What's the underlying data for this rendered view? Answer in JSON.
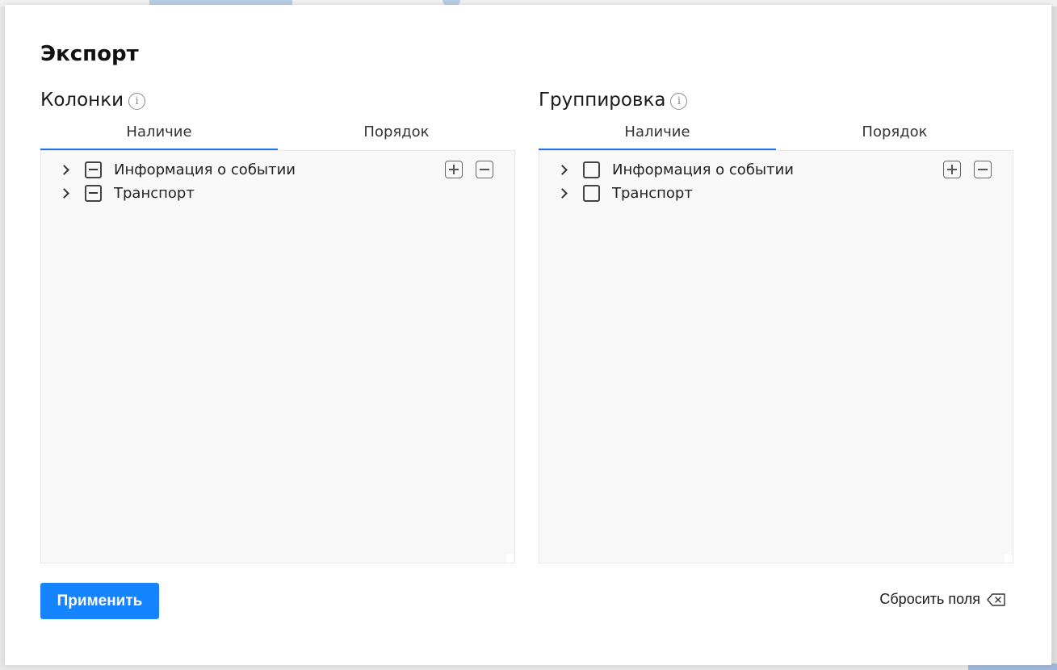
{
  "modal": {
    "title": "Экспорт"
  },
  "columns": {
    "title": "Колонки",
    "info_icon": "info-icon",
    "tabs": [
      {
        "label": "Наличие",
        "active": true
      },
      {
        "label": "Порядок",
        "active": false
      }
    ],
    "tools": {
      "expand_icon": "plus-square-icon",
      "collapse_icon": "minus-square-icon"
    },
    "items": [
      {
        "label": "Информация о событии",
        "check_state": "indeterminate"
      },
      {
        "label": "Транспорт",
        "check_state": "indeterminate"
      }
    ]
  },
  "grouping": {
    "title": "Группировка",
    "info_icon": "info-icon",
    "tabs": [
      {
        "label": "Наличие",
        "active": true
      },
      {
        "label": "Порядок",
        "active": false
      }
    ],
    "tools": {
      "expand_icon": "plus-square-icon",
      "collapse_icon": "minus-square-icon"
    },
    "items": [
      {
        "label": "Информация о событии",
        "check_state": "unchecked"
      },
      {
        "label": "Транспорт",
        "check_state": "unchecked"
      }
    ]
  },
  "footer": {
    "apply_label": "Применить",
    "reset_label": "Сбросить поля",
    "reset_icon": "backspace-icon"
  },
  "colors": {
    "accent": "#1784ff",
    "tab_underline": "#1a73e8",
    "tree_background": "#f8f8f8"
  }
}
